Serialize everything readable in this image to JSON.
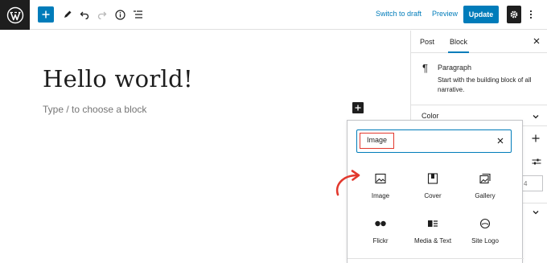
{
  "toolbar": {
    "switch_to_draft": "Switch to draft",
    "preview": "Preview",
    "update": "Update",
    "accent_color": "#007cba",
    "icons": [
      "wordpress-logo-icon",
      "plus-icon",
      "pencil-icon",
      "undo-icon",
      "redo-icon",
      "info-icon",
      "list-view-icon",
      "gear-icon",
      "kebab-icon"
    ]
  },
  "editor": {
    "title": "Hello world!",
    "placeholder": "Type / to choose a block"
  },
  "sidebar": {
    "tabs": [
      {
        "label": "Post",
        "active": false
      },
      {
        "label": "Block",
        "active": true
      }
    ],
    "block_card": {
      "name": "Paragraph",
      "description": "Start with the building block of all narrative."
    },
    "color_panel": "Color",
    "number_value": "4"
  },
  "inserter": {
    "search_value": "Image",
    "highlight_color": "#e2382d",
    "blocks": [
      {
        "label": "Image",
        "icon": "image-icon"
      },
      {
        "label": "Cover",
        "icon": "cover-icon"
      },
      {
        "label": "Gallery",
        "icon": "gallery-icon"
      },
      {
        "label": "Flickr",
        "icon": "flickr-icon"
      },
      {
        "label": "Media & Text",
        "icon": "media-text-icon"
      },
      {
        "label": "Site Logo",
        "icon": "site-logo-icon"
      }
    ]
  }
}
